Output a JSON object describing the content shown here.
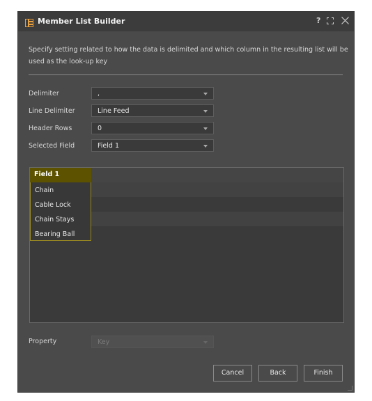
{
  "dialog": {
    "title": "Member List Builder",
    "help_label": "?",
    "description": "Specify setting related to how the data is delimited and which column in the resulting list will be used as the look-up key"
  },
  "settings": {
    "delimiter": {
      "label": "Delimiter",
      "value": ","
    },
    "line_delimiter": {
      "label": "Line Delimiter",
      "value": "Line Feed"
    },
    "header_rows": {
      "label": "Header Rows",
      "value": "0"
    },
    "selected_field": {
      "label": "Selected Field",
      "value": "Field 1"
    }
  },
  "grid": {
    "column_header": "Field 1",
    "rows": [
      "Chain",
      "Cable Lock",
      "Chain Stays",
      "Bearing Ball"
    ]
  },
  "property": {
    "label": "Property",
    "placeholder": "Key"
  },
  "buttons": {
    "cancel": "Cancel",
    "back": "Back",
    "finish": "Finish"
  },
  "icons": {
    "title": "list-builder-icon",
    "maximize": "maximize-icon",
    "close": "close-icon"
  },
  "colors": {
    "accent_header": "#5c5200",
    "accent_border": "#9a8a22",
    "dialog_bg": "#4a4a4a"
  }
}
